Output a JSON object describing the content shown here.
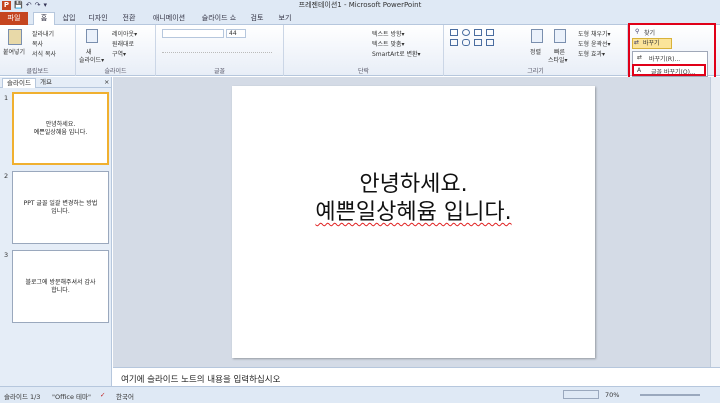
{
  "app": {
    "title": "프레젠테이션1 - Microsoft PowerPoint",
    "icon": "P"
  },
  "qat": [
    "💾",
    "↶",
    "↷",
    "▾"
  ],
  "tabs": {
    "file": "파일",
    "home": "홈",
    "insert": "삽입",
    "design": "디자인",
    "transitions": "전환",
    "animations": "애니메이션",
    "slideshow": "슬라이드 쇼",
    "review": "검토",
    "view": "보기"
  },
  "ribbon": {
    "clipboard": {
      "label": "클립보드",
      "paste": "붙여넣기",
      "cut": "잘라내기",
      "copy": "복사",
      "format": "서식 복사"
    },
    "slides": {
      "label": "슬라이드",
      "new": "새",
      "new2": "슬라이드▾",
      "layout": "레이아웃▾",
      "reset": "원래대로",
      "section": "구역▾"
    },
    "font": {
      "label": "글꼴",
      "size": "44"
    },
    "paragraph": {
      "label": "단락",
      "textdir": "텍스트 방향▾",
      "textalign": "텍스트 맞춤▾",
      "smartart": "SmartArt로 변환▾"
    },
    "drawing": {
      "label": "그리기",
      "arrange": "정렬",
      "quickstyles": "빠른",
      "quickstyles2": "스타일▾",
      "fill": "도형 채우기▾",
      "outline": "도형 윤곽선▾",
      "effects": "도형 효과▾"
    },
    "editing": {
      "find": "찾기",
      "replace": "바꾸기",
      "replace_item": "바꾸기(R)...",
      "replace_font": "글꼴 바꾸기(O)..."
    }
  },
  "panel": {
    "tab_slides": "슬라이드",
    "tab_outline": "개요",
    "close": "×",
    "slides": [
      {
        "num": "1",
        "l1": "안녕하세요.",
        "l2": "예쁜일상혜윰 입니다."
      },
      {
        "num": "2",
        "l1": "PPT 글꼴 일괄 변경하는 방법",
        "l2": "입니다."
      },
      {
        "num": "3",
        "l1": "블로그에 방문해주셔서 감사",
        "l2": "합니다."
      }
    ]
  },
  "slide": {
    "line1": "안녕하세요.",
    "line2": "예쁜일상혜윰 입니다."
  },
  "notes": {
    "placeholder": "여기에 슬라이드 노트의 내용을 입력하십시오"
  },
  "status": {
    "slide": "슬라이드 1/3",
    "theme": "\"Office 테마\"",
    "lang": "한국어",
    "zoom": "70%"
  }
}
